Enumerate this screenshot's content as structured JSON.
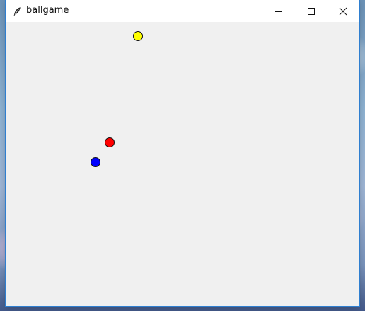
{
  "window": {
    "title": "ballgame"
  },
  "titlebar": {
    "icon": "feather-icon",
    "controls": [
      "minimize-icon",
      "maximize-icon",
      "close-icon"
    ]
  },
  "canvas": {
    "background": "#f0f0f0",
    "balls": [
      {
        "name": "yellow-ball",
        "color": "#ffff00"
      },
      {
        "name": "red-ball",
        "color": "#ff0000"
      },
      {
        "name": "blue-ball",
        "color": "#0000ff"
      }
    ]
  }
}
